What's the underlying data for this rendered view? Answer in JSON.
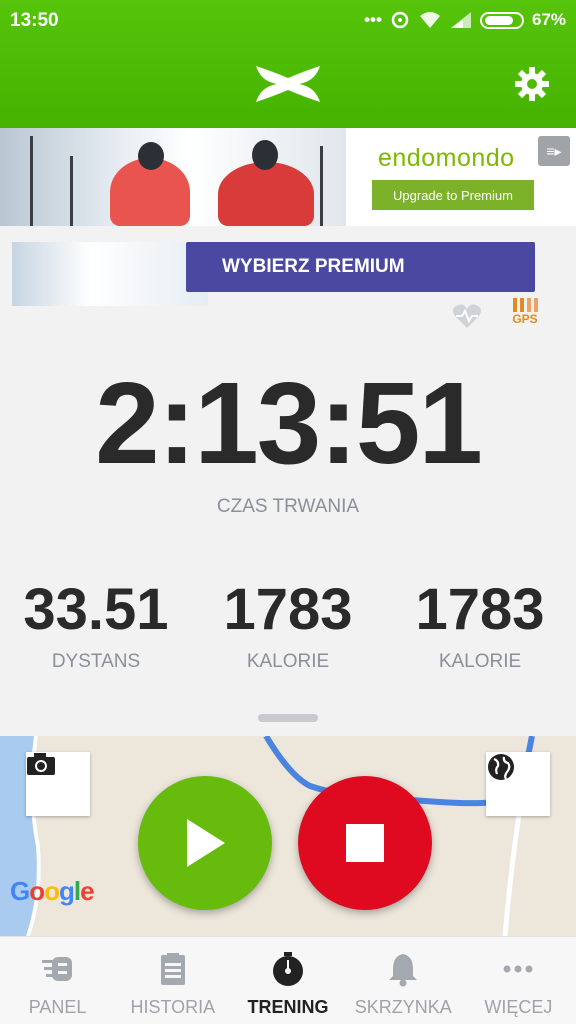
{
  "status": {
    "time": "13:50",
    "icons": [
      "more-icon",
      "sync-icon",
      "wifi-icon",
      "signal-icon",
      "battery-icon"
    ],
    "battery": "67%"
  },
  "header": {
    "logo_icon": "under-armour-logo-icon",
    "settings_icon": "gear-icon"
  },
  "ad": {
    "brand": "endomondo",
    "button": "Upgrade to Premium",
    "brand_color": "#7cb900"
  },
  "premium": {
    "button": "WYBIERZ PREMIUM",
    "color": "#4a48a0"
  },
  "indicators": {
    "heart_icon": "heart-rate-icon",
    "gps_label": "GPS",
    "gps_color": "#e58a22"
  },
  "workout": {
    "timer": "2:13:51",
    "timer_label": "CZAS TRWANIA",
    "stats": [
      {
        "value": "33.51",
        "label": "DYSTANS"
      },
      {
        "value": "1783",
        "label": "KALORIE"
      },
      {
        "value": "1783",
        "label": "KALORIE"
      }
    ]
  },
  "map": {
    "camera_icon": "camera-icon",
    "globe_icon": "globe-icon",
    "attribution": "Google"
  },
  "controls": {
    "play_icon": "play-icon",
    "stop_icon": "stop-icon",
    "play_color": "#66bb0d",
    "stop_color": "#df0a20"
  },
  "nav": [
    {
      "label": "PANEL",
      "icon": "dashboard-icon",
      "active": false
    },
    {
      "label": "HISTORIA",
      "icon": "clipboard-icon",
      "active": false
    },
    {
      "label": "TRENING",
      "icon": "stopwatch-icon",
      "active": true
    },
    {
      "label": "SKRZYNKA",
      "icon": "bell-icon",
      "active": false
    },
    {
      "label": "WIĘCEJ",
      "icon": "more-icon",
      "active": false
    }
  ]
}
